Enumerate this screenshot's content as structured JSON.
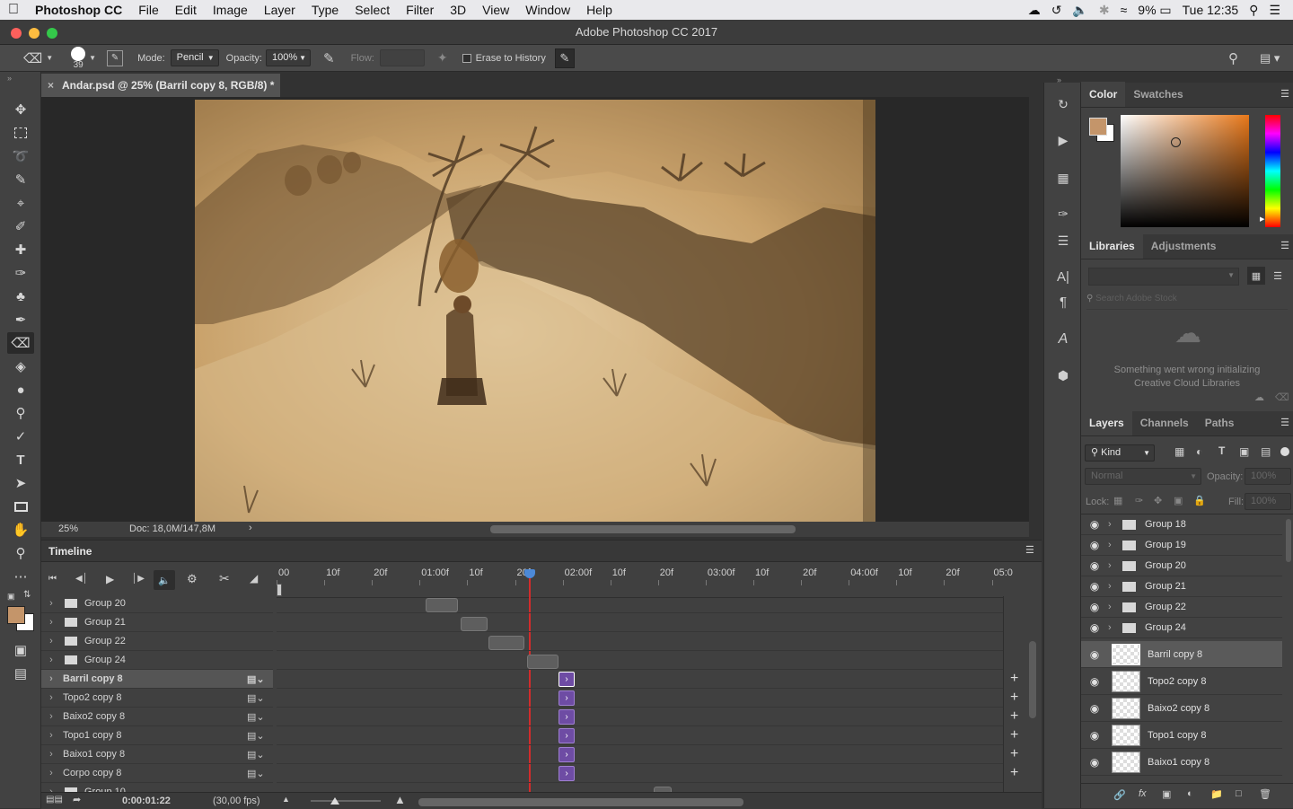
{
  "menubar": {
    "items": [
      "Photoshop CC",
      "File",
      "Edit",
      "Image",
      "Layer",
      "Type",
      "Select",
      "Filter",
      "3D",
      "View",
      "Window",
      "Help"
    ],
    "battery": "9%",
    "clock": "Tue 12:35"
  },
  "window": {
    "title": "Adobe Photoshop CC 2017"
  },
  "options": {
    "brush_size": "39",
    "mode_label": "Mode:",
    "mode_value": "Pencil",
    "opacity_label": "Opacity:",
    "opacity_value": "100%",
    "flow_label": "Flow:",
    "erase_history": "Erase to History"
  },
  "document": {
    "tab": "Andar.psd @ 25% (Barril copy 8, RGB/8) *",
    "zoom": "25%",
    "doc_info": "Doc: 18,0M/147,8M"
  },
  "timeline": {
    "title": "Timeline",
    "ruler": [
      "00",
      "10f",
      "20f",
      "01:00f",
      "10f",
      "20f",
      "02:00f",
      "10f",
      "20f",
      "03:00f",
      "10f",
      "20f",
      "04:00f",
      "10f",
      "20f",
      "05:0"
    ],
    "groups": [
      "Group 20",
      "Group 21",
      "Group 22",
      "Group 24"
    ],
    "layers": [
      "Barril copy 8",
      "Topo2 copy 8",
      "Baixo2 copy 8",
      "Topo1 copy 8",
      "Baixo1 copy 8",
      "Corpo copy 8"
    ],
    "partial_row": "Group 10",
    "current_time": "0:00:01:22",
    "fps": "(30,00 fps)"
  },
  "panels": {
    "color_tabs": [
      "Color",
      "Swatches"
    ],
    "lib_tabs": [
      "Libraries",
      "Adjustments"
    ],
    "lib_search_placeholder": "Search Adobe Stock",
    "lib_error": "Something went wrong initializing Creative Cloud Libraries",
    "layers_tabs": [
      "Layers",
      "Channels",
      "Paths"
    ],
    "kind": "Kind",
    "blend": "Normal",
    "opacity_label": "Opacity:",
    "opacity_value": "100%",
    "lock_label": "Lock:",
    "fill_label": "Fill:",
    "fill_value": "100%",
    "group_layers": [
      "Group 18",
      "Group 19",
      "Group 20",
      "Group 21",
      "Group 22",
      "Group 24"
    ],
    "pixel_layers": [
      "Barril copy 8",
      "Topo2 copy 8",
      "Baixo2 copy 8",
      "Topo1 copy 8",
      "Baixo1 copy 8"
    ]
  },
  "colors": {
    "foreground": "#c4956a",
    "background": "#ffffff",
    "selection": "#5a5a5a",
    "playhead": "#d22c2c",
    "clip_purple": "#6e4ca4"
  }
}
